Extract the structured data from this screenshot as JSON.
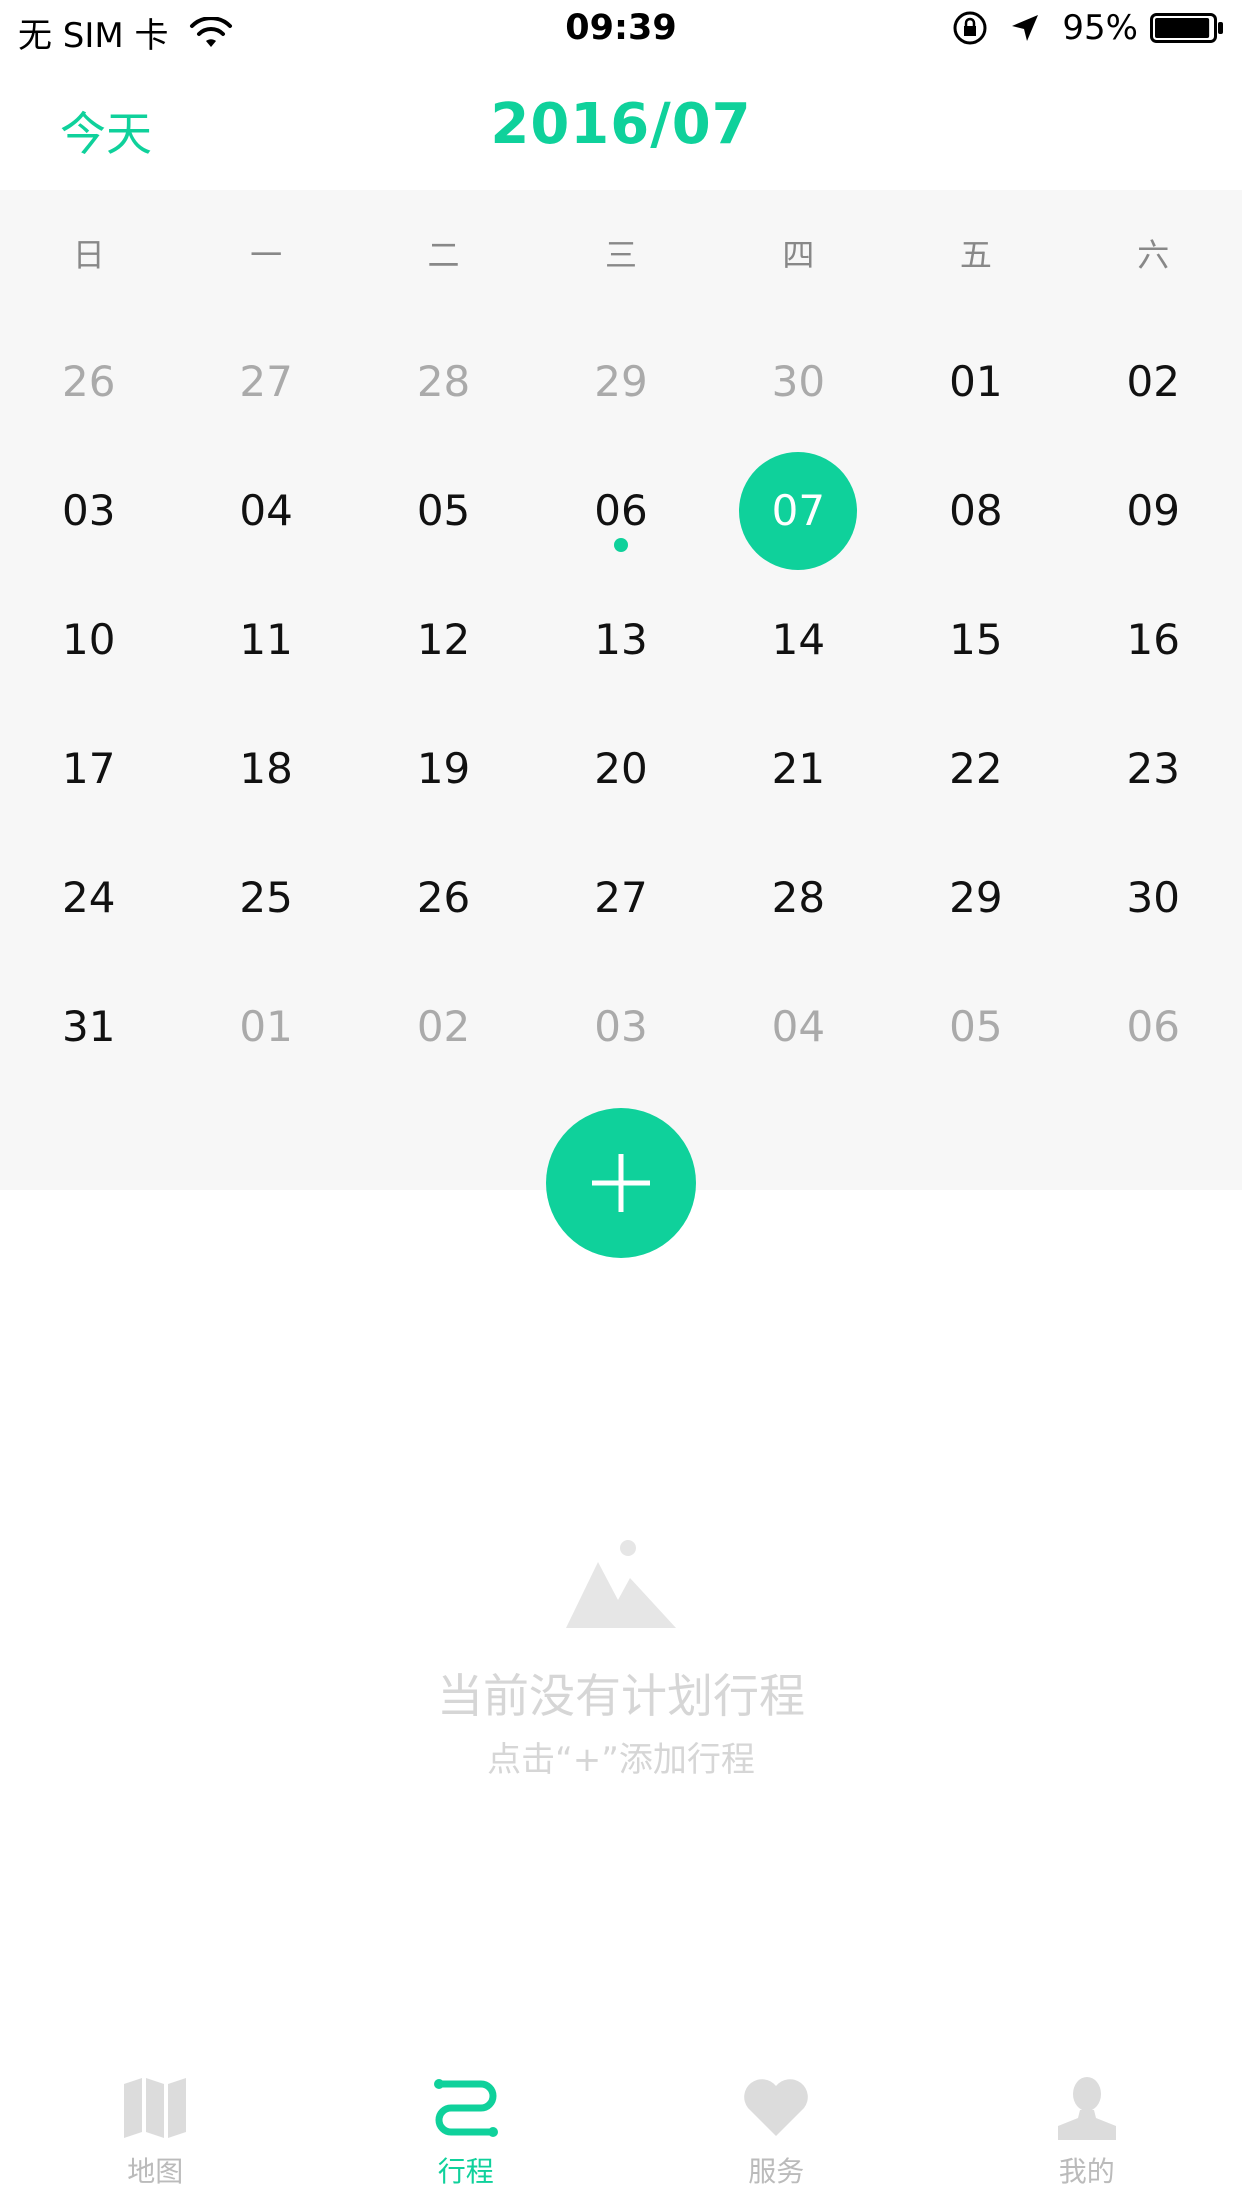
{
  "status_bar": {
    "carrier": "无 SIM 卡",
    "time": "09:39",
    "battery": "95%",
    "battery_level": 0.95,
    "icons": [
      "wifi-icon",
      "rotation-lock-icon",
      "location-icon",
      "battery-icon"
    ]
  },
  "header": {
    "today_label": "今天",
    "month_title": "2016/07"
  },
  "calendar": {
    "weekdays": [
      "日",
      "一",
      "二",
      "三",
      "四",
      "五",
      "六"
    ],
    "weeks": [
      [
        {
          "d": "26",
          "muted": true
        },
        {
          "d": "27",
          "muted": true
        },
        {
          "d": "28",
          "muted": true
        },
        {
          "d": "29",
          "muted": true
        },
        {
          "d": "30",
          "muted": true
        },
        {
          "d": "01"
        },
        {
          "d": "02"
        }
      ],
      [
        {
          "d": "03"
        },
        {
          "d": "04"
        },
        {
          "d": "05"
        },
        {
          "d": "06",
          "dot": true
        },
        {
          "d": "07",
          "selected": true
        },
        {
          "d": "08"
        },
        {
          "d": "09"
        }
      ],
      [
        {
          "d": "10"
        },
        {
          "d": "11"
        },
        {
          "d": "12"
        },
        {
          "d": "13"
        },
        {
          "d": "14"
        },
        {
          "d": "15"
        },
        {
          "d": "16"
        }
      ],
      [
        {
          "d": "17"
        },
        {
          "d": "18"
        },
        {
          "d": "19"
        },
        {
          "d": "20"
        },
        {
          "d": "21"
        },
        {
          "d": "22"
        },
        {
          "d": "23"
        }
      ],
      [
        {
          "d": "24"
        },
        {
          "d": "25"
        },
        {
          "d": "26"
        },
        {
          "d": "27"
        },
        {
          "d": "28"
        },
        {
          "d": "29"
        },
        {
          "d": "30"
        }
      ],
      [
        {
          "d": "31"
        },
        {
          "d": "01",
          "muted": true
        },
        {
          "d": "02",
          "muted": true
        },
        {
          "d": "03",
          "muted": true
        },
        {
          "d": "04",
          "muted": true
        },
        {
          "d": "05",
          "muted": true
        },
        {
          "d": "06",
          "muted": true
        }
      ]
    ]
  },
  "add_button": {
    "icon": "plus-icon"
  },
  "empty_state": {
    "icon": "mountain-image-icon",
    "title": "当前没有计划行程",
    "subtitle": "点击“+”添加行程"
  },
  "tabs": [
    {
      "label": "地图",
      "icon": "map-icon",
      "active": false
    },
    {
      "label": "行程",
      "icon": "itinerary-icon",
      "active": true
    },
    {
      "label": "服务",
      "icon": "heart-icon",
      "active": false
    },
    {
      "label": "我的",
      "icon": "profile-icon",
      "active": false
    }
  ],
  "colors": {
    "accent": "#0fd19b",
    "muted_text": "#aaaaaa",
    "calendar_bg": "#f7f7f7",
    "inactive_tab": "#cccccc"
  }
}
